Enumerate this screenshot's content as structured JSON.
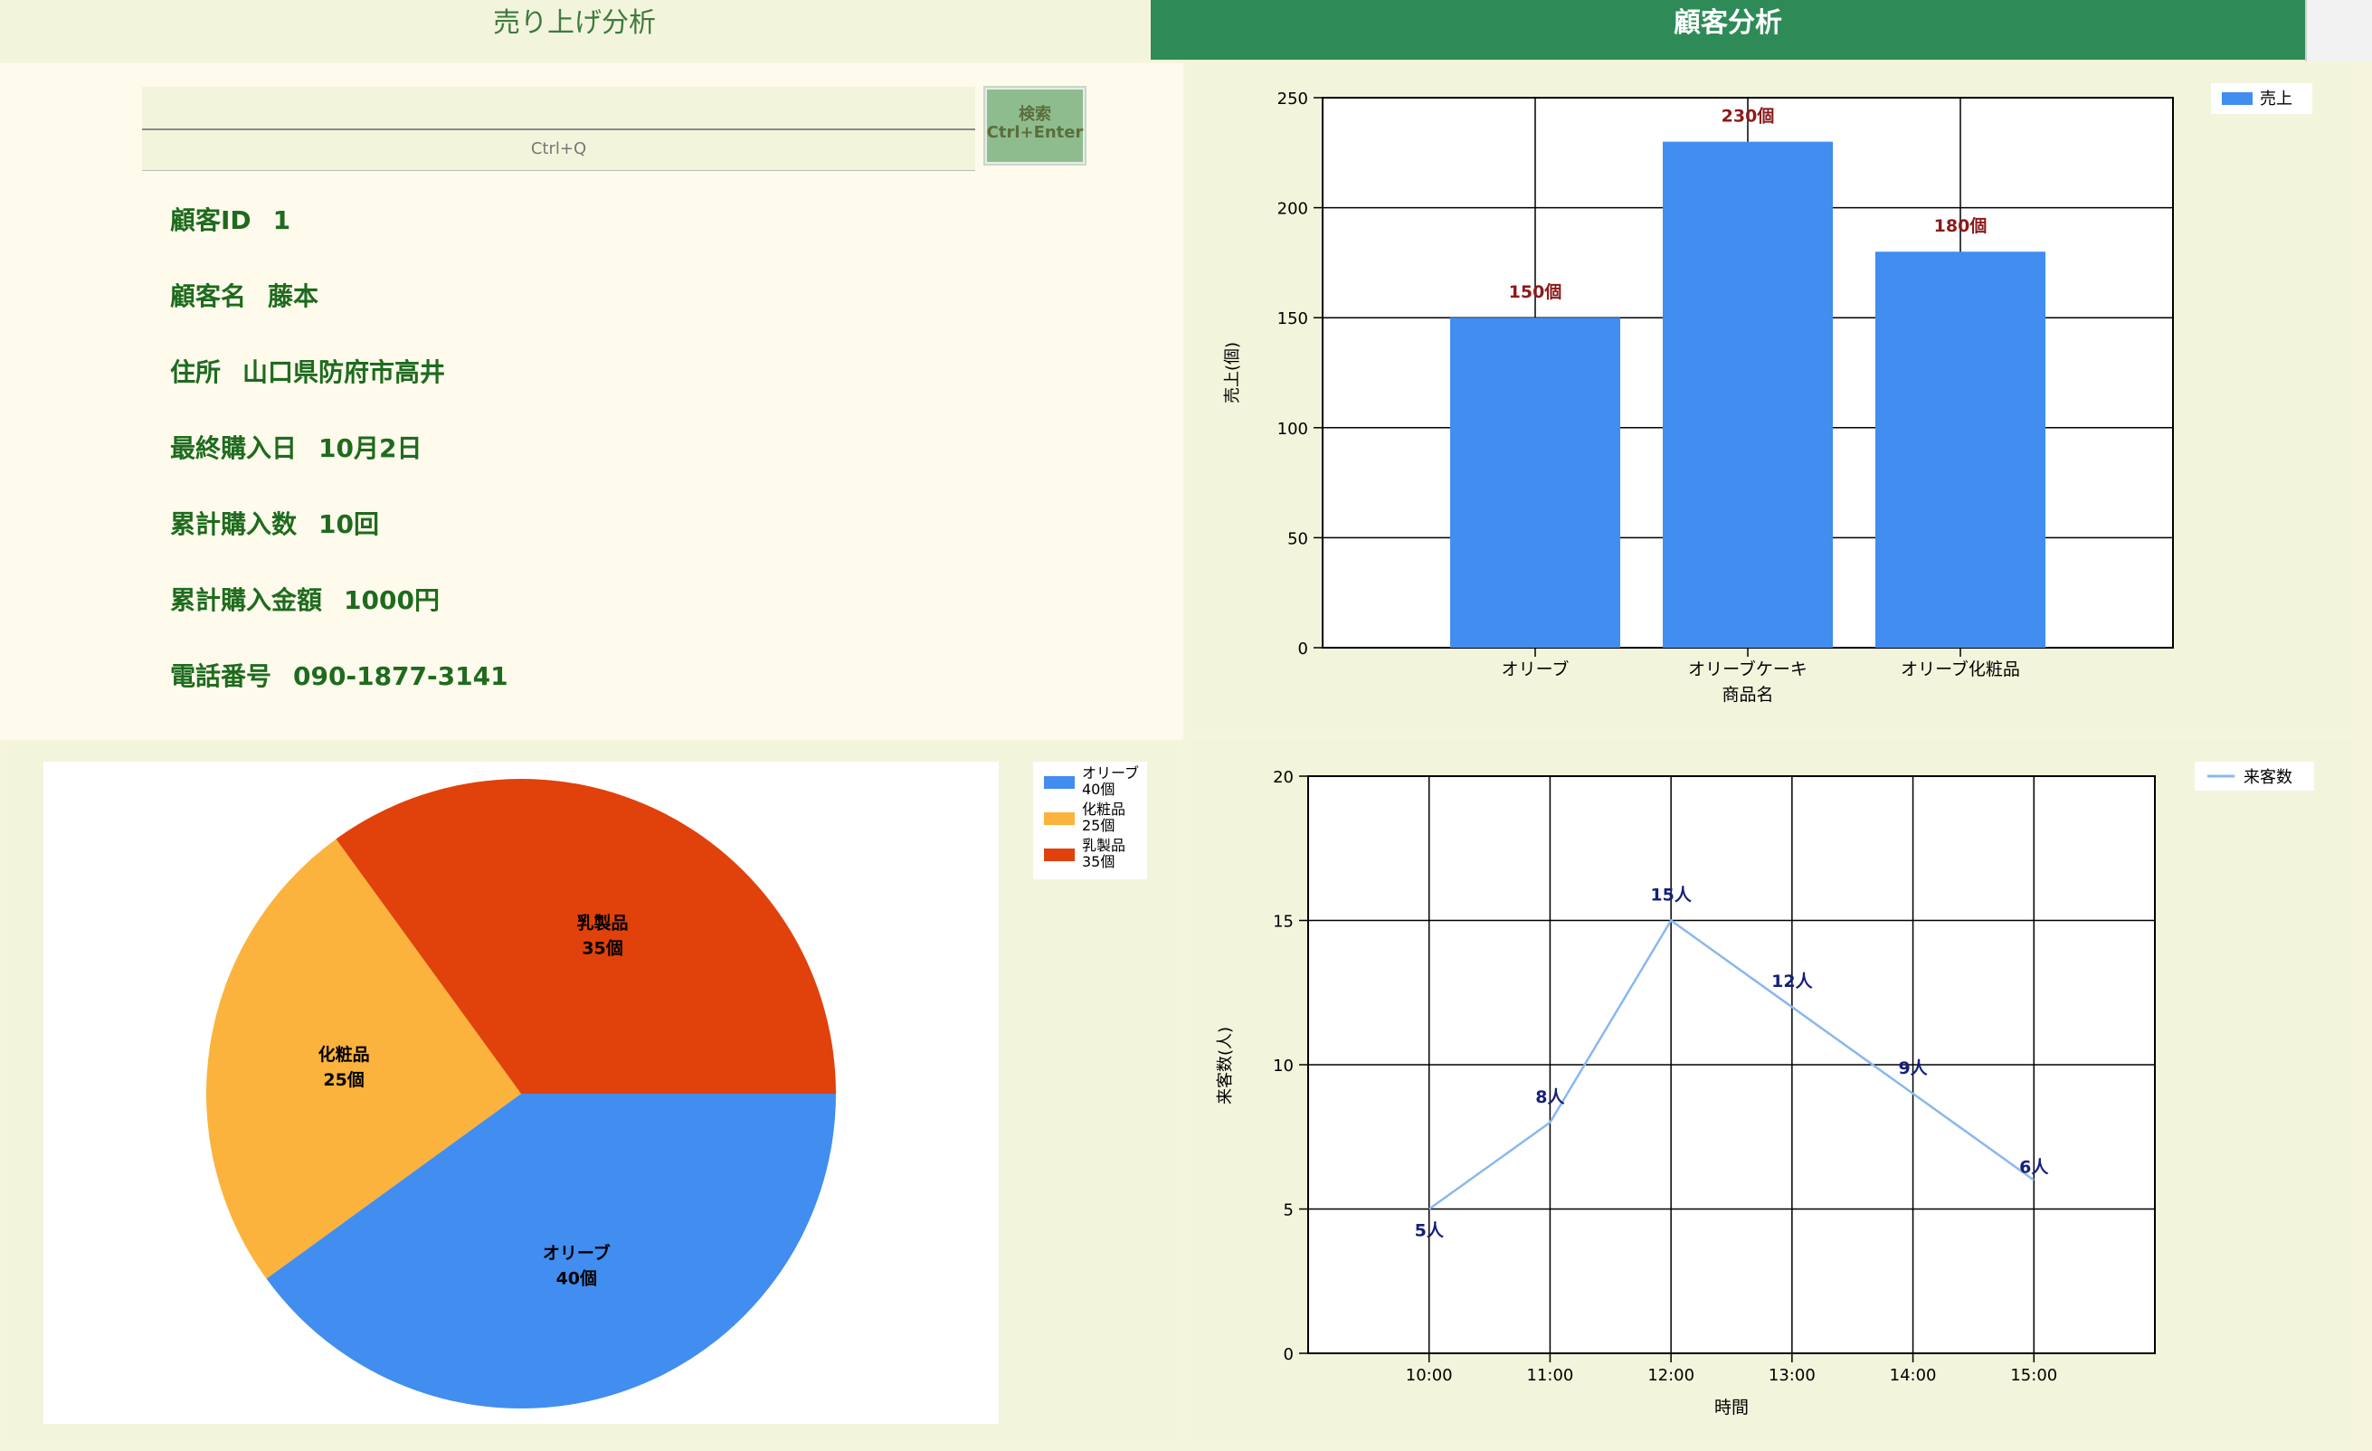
{
  "tabs": [
    {
      "label": "売り上げ分析",
      "active": false
    },
    {
      "label": "顧客分析",
      "active": true
    }
  ],
  "search": {
    "value": "",
    "placeholder": "",
    "hint": "Ctrl+Q",
    "button_line1": "検索",
    "button_line2": "Ctrl+Enter"
  },
  "customer": {
    "id_label": "顧客ID",
    "id_value": "1",
    "name_label": "顧客名",
    "name_value": "藤本",
    "address_label": "住所",
    "address_value": "山口県防府市高井",
    "last_purchase_label": "最終購入日",
    "last_purchase_value": "10月2日",
    "purchase_count_label": "累計購入数",
    "purchase_count_value": "10回",
    "purchase_total_label": "累計購入金額",
    "purchase_total_value": "1000円",
    "phone_label": "電話番号",
    "phone_value": "090-1877-3141"
  },
  "colors": {
    "bar": "#418df0",
    "bar_label": "#8b1a1a",
    "pie_olive": "#418df0",
    "pie_cosmetics": "#fbb33d",
    "pie_dairy": "#e1410a",
    "line": "#8ab8ec",
    "line_label": "#16207a",
    "tab_active": "#2e8b57",
    "info_text": "#1e6b1e"
  },
  "chart_data": [
    {
      "type": "bar",
      "categories": [
        "オリーブ",
        "オリーブケーキ",
        "オリーブ化粧品"
      ],
      "series": [
        {
          "name": "売上",
          "values": [
            150,
            230,
            180
          ]
        }
      ],
      "data_labels": [
        "150個",
        "230個",
        "180個"
      ],
      "xlabel": "商品名",
      "ylabel": "売上(個)",
      "ylim": [
        0,
        250
      ],
      "yticks": [
        0,
        50,
        100,
        150,
        200,
        250
      ],
      "grid": true,
      "legend": "top-right"
    },
    {
      "type": "pie",
      "labels": [
        "オリーブ",
        "化粧品",
        "乳製品"
      ],
      "values": [
        40,
        25,
        35
      ],
      "value_labels": [
        "40個",
        "25個",
        "35個"
      ],
      "legend": "top-right"
    },
    {
      "type": "line",
      "x": [
        "10:00",
        "11:00",
        "12:00",
        "13:00",
        "14:00",
        "15:00"
      ],
      "series": [
        {
          "name": "来客数",
          "values": [
            5,
            8,
            15,
            12,
            9,
            6
          ]
        }
      ],
      "data_labels": [
        "5人",
        "8人",
        "15人",
        "12人",
        "9人",
        "6人"
      ],
      "xlabel": "時間",
      "ylabel": "来客数(人)",
      "ylim": [
        0,
        20
      ],
      "yticks": [
        0,
        5,
        10,
        15,
        20
      ],
      "grid": true,
      "legend": "top-right"
    }
  ]
}
